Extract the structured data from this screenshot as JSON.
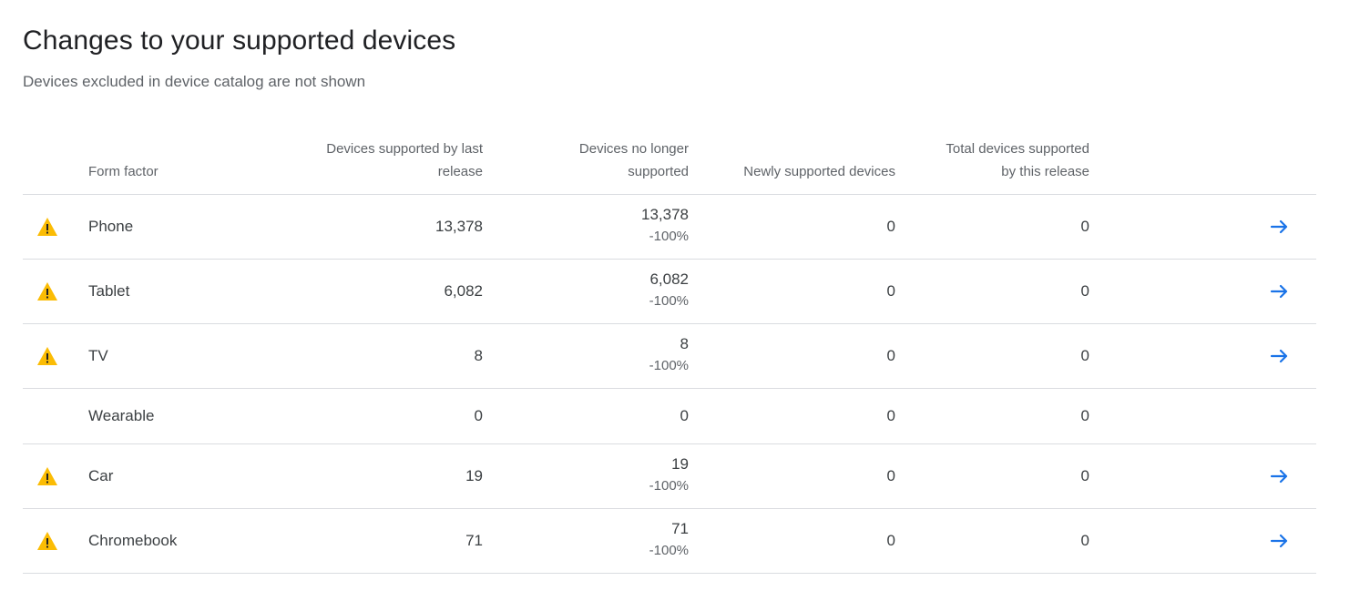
{
  "header": {
    "title": "Changes to your supported devices",
    "subtitle": "Devices excluded in device catalog are not shown"
  },
  "table": {
    "columns": {
      "form_factor": "Form factor",
      "last_release_line1": "Devices supported by last",
      "last_release_line2": "release",
      "no_longer_line1": "Devices no longer",
      "no_longer_line2": "supported",
      "newly": "Newly supported devices",
      "total_line1": "Total devices supported",
      "total_line2": "by this release"
    },
    "rows": [
      {
        "form_factor": "Phone",
        "last_release": "13,378",
        "no_longer": "13,378",
        "no_longer_pct": "-100%",
        "newly": "0",
        "total": "0",
        "warning": true,
        "arrow": true
      },
      {
        "form_factor": "Tablet",
        "last_release": "6,082",
        "no_longer": "6,082",
        "no_longer_pct": "-100%",
        "newly": "0",
        "total": "0",
        "warning": true,
        "arrow": true
      },
      {
        "form_factor": "TV",
        "last_release": "8",
        "no_longer": "8",
        "no_longer_pct": "-100%",
        "newly": "0",
        "total": "0",
        "warning": true,
        "arrow": true
      },
      {
        "form_factor": "Wearable",
        "last_release": "0",
        "no_longer": "0",
        "no_longer_pct": "",
        "newly": "0",
        "total": "0",
        "warning": false,
        "arrow": false
      },
      {
        "form_factor": "Car",
        "last_release": "19",
        "no_longer": "19",
        "no_longer_pct": "-100%",
        "newly": "0",
        "total": "0",
        "warning": true,
        "arrow": true
      },
      {
        "form_factor": "Chromebook",
        "last_release": "71",
        "no_longer": "71",
        "no_longer_pct": "-100%",
        "newly": "0",
        "total": "0",
        "warning": true,
        "arrow": true
      }
    ]
  },
  "icons": {
    "warning": "warning-icon",
    "arrow": "arrow-right-icon"
  },
  "colors": {
    "warning_fill": "#fbbc04",
    "arrow": "#1a73e8",
    "divider": "#dadce0"
  }
}
